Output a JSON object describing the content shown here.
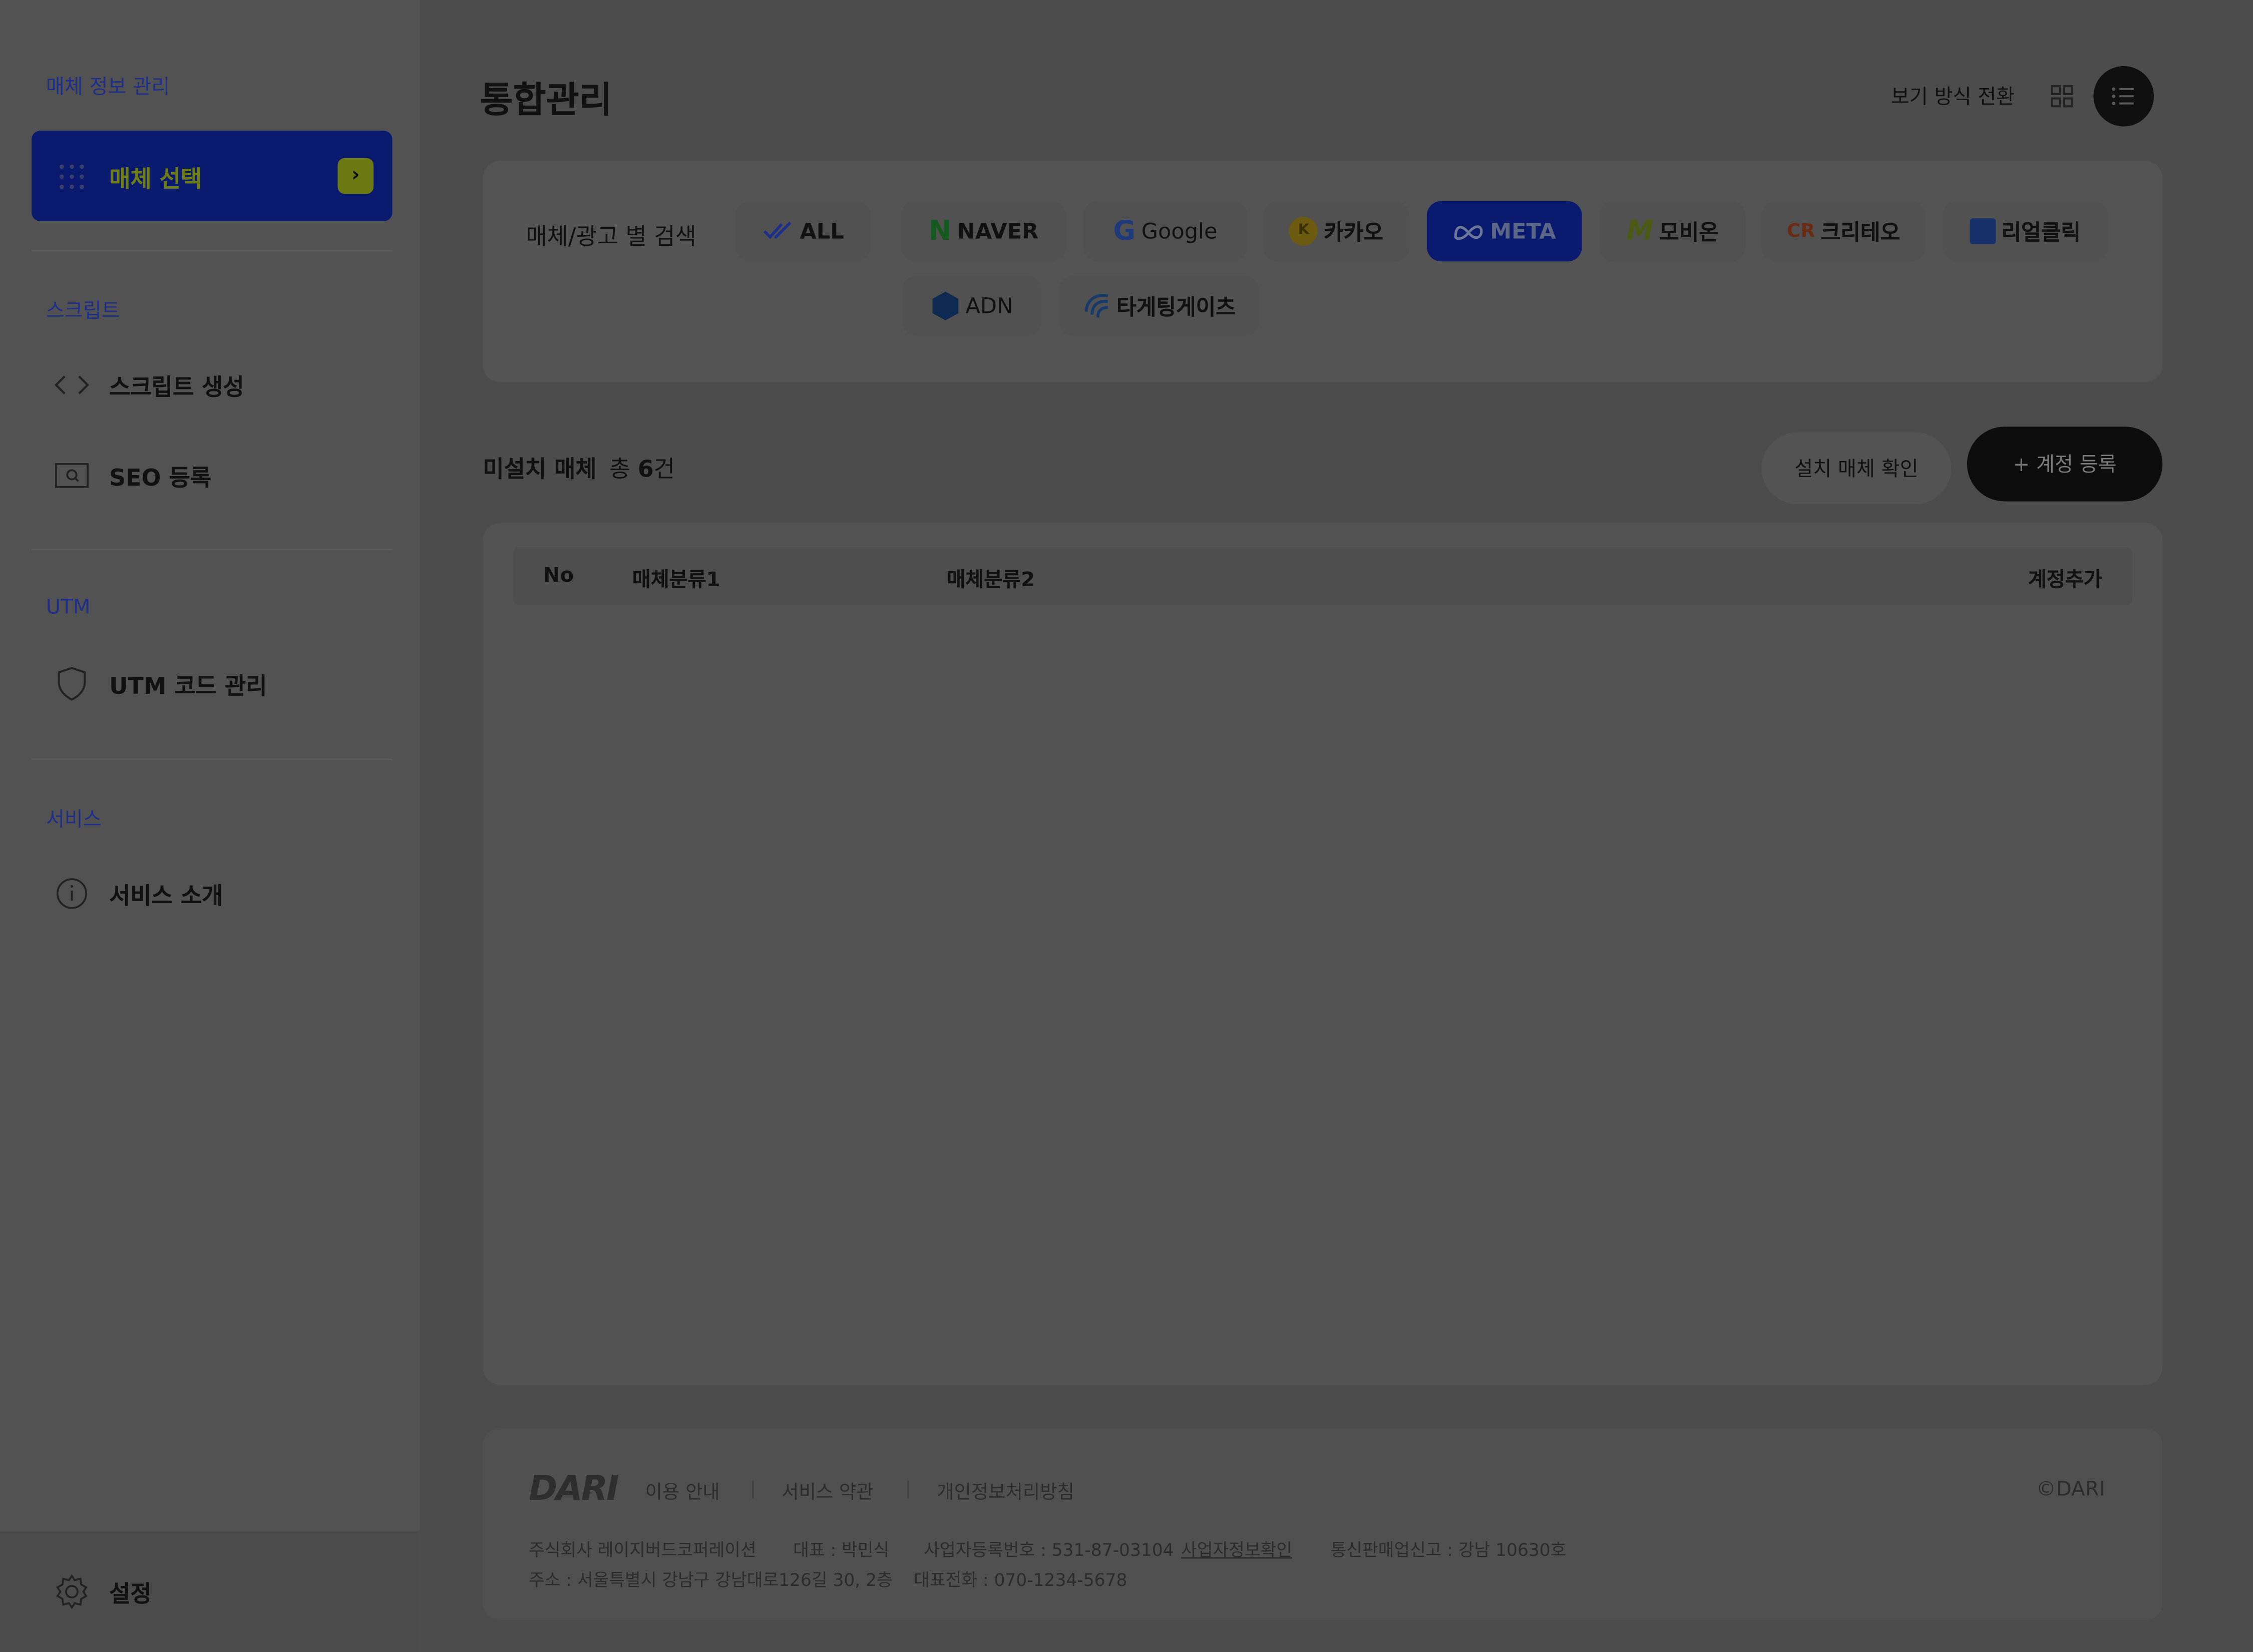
{
  "sidebar": {
    "section_media": "매체 정보 관리",
    "media_select_label": "매체 선택",
    "section_script": "스크립트",
    "script_create": "스크립트 생성",
    "seo_register": "SEO 등록",
    "section_utm": "UTM",
    "utm_manage": "UTM 코드 관리",
    "section_service": "서비스",
    "service_intro": "서비스 소개",
    "settings": "설정"
  },
  "header": {
    "title": "통합관리",
    "view_toggle": "보기 방식 전환"
  },
  "filter": {
    "label": "매체/광고 별 검색",
    "chips": [
      {
        "label": "ALL",
        "icon": "check-icon"
      },
      {
        "label": "NAVER",
        "icon": "naver-logo"
      },
      {
        "label": "Google",
        "icon": "google-logo"
      },
      {
        "label": "카카오",
        "icon": "kakao-logo"
      },
      {
        "label": "META",
        "icon": "meta-logo",
        "active": true
      },
      {
        "label": "모비온",
        "icon": "mobion-logo"
      },
      {
        "label": "크리테오",
        "icon": "criteo-logo"
      },
      {
        "label": "리얼클릭",
        "icon": "realclick-logo"
      },
      {
        "label": "ADN",
        "icon": "adn-logo"
      },
      {
        "label": "타게팅게이츠",
        "icon": "targetinggates-logo"
      }
    ]
  },
  "list": {
    "title": "미설치 매체",
    "count_prefix": "총 ",
    "count": "6",
    "count_suffix": "건",
    "check_button": "설치 매체 확인",
    "add_button": "+ 계정 등록",
    "columns": [
      "No",
      "매체분류1",
      "매체분류2",
      "계정추가"
    ]
  },
  "footer": {
    "logo": "DARI",
    "links": [
      "이용 안내",
      "서비스 약관",
      "개인정보처리방침"
    ],
    "copyright": "©DARI",
    "company": "주식회사 레이지버드코퍼레이션",
    "ceo": "대표 : 박민식",
    "biz_no": "사업자등록번호 : 531-87-03104",
    "biz_check": "사업자정보확인",
    "ecommerce": "통신판매업신고 : 강남 10630호",
    "address": "주소 : 서울특별시 강남구 강남대로126길 30, 2층",
    "phone": "대표전화 : 070-1234-5678"
  },
  "colors": {
    "accent": "#0a1a6e",
    "accent_highlight": "#6b7a12",
    "overlay": "#4c4c4c"
  }
}
